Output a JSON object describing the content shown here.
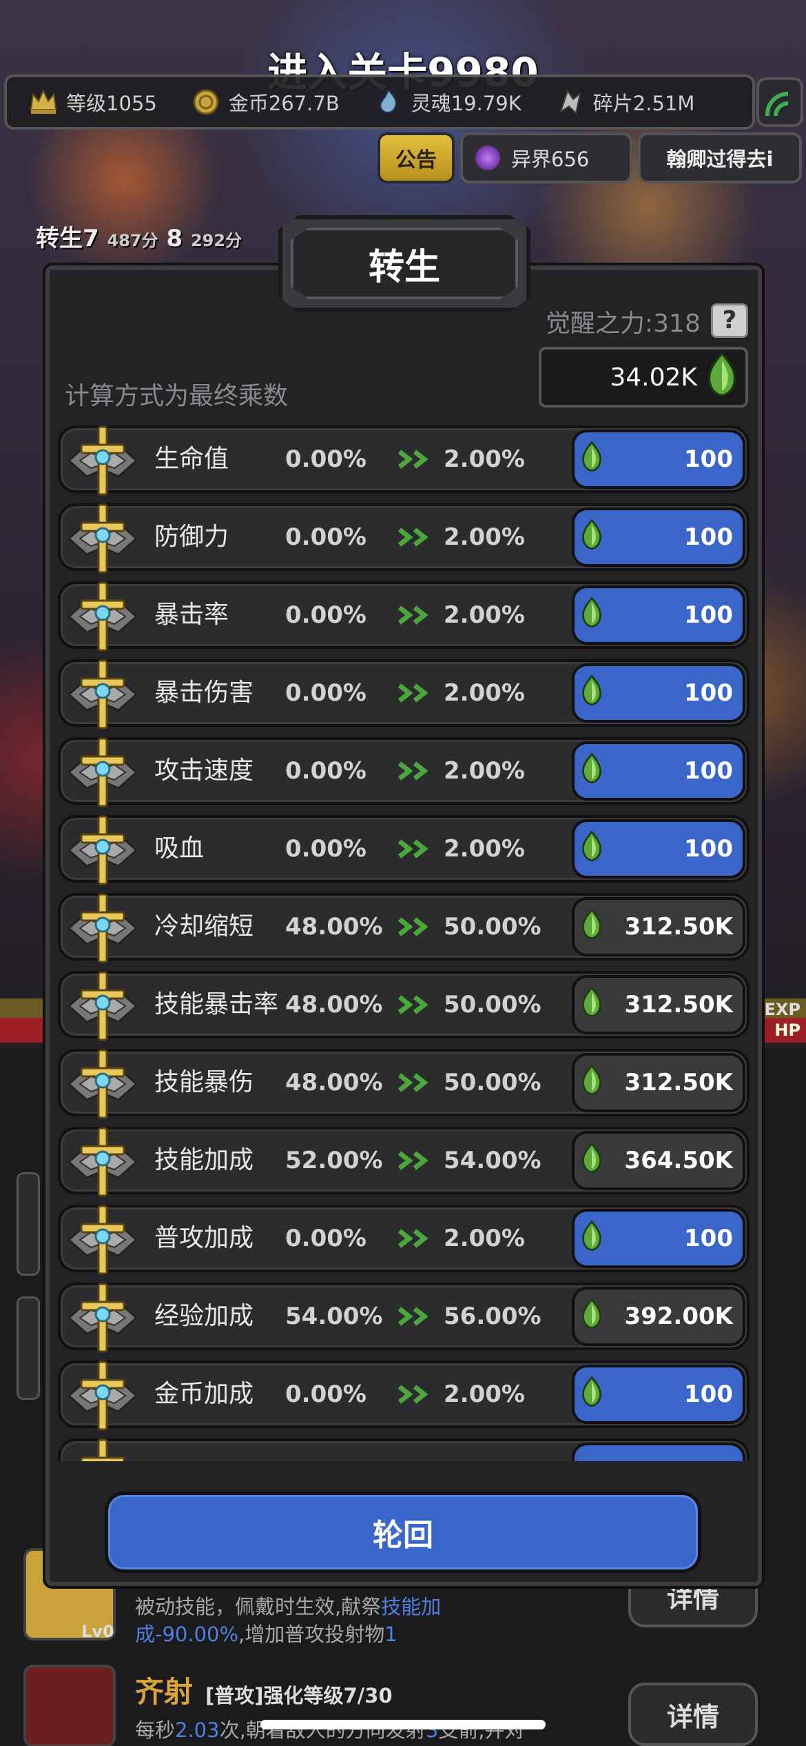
{
  "stage_title": "进入关卡9980",
  "currencies": [
    {
      "icon": "crown-icon",
      "label": "等级1055",
      "color": "#d6b04a"
    },
    {
      "icon": "gold-coin-icon",
      "label": "金币267.7B",
      "color": "#c9a43f"
    },
    {
      "icon": "soul-flame-icon",
      "label": "灵魂19.79K",
      "color": "#7fb0d8"
    },
    {
      "icon": "shard-icon",
      "label": "碎片2.51M",
      "color": "#bbbbbb"
    }
  ],
  "top_buttons": {
    "notice": "公告",
    "realm": "异界656",
    "player": "翰卿过得去i"
  },
  "rebirth_info": {
    "main": "转生7",
    "sub1": "487分",
    "mid": "8",
    "sub2": "292分"
  },
  "dialog": {
    "title": "转生",
    "awaken_power": "觉醒之力:318",
    "help": "?",
    "calc_note": "计算方式为最终乘数",
    "balance": "34.02K"
  },
  "rows": [
    {
      "name": "生命值",
      "current": "0.00%",
      "next": "2.00%",
      "cost": "100",
      "style": "blue"
    },
    {
      "name": "防御力",
      "current": "0.00%",
      "next": "2.00%",
      "cost": "100",
      "style": "blue"
    },
    {
      "name": "暴击率",
      "current": "0.00%",
      "next": "2.00%",
      "cost": "100",
      "style": "blue"
    },
    {
      "name": "暴击伤害",
      "current": "0.00%",
      "next": "2.00%",
      "cost": "100",
      "style": "blue"
    },
    {
      "name": "攻击速度",
      "current": "0.00%",
      "next": "2.00%",
      "cost": "100",
      "style": "blue"
    },
    {
      "name": "吸血",
      "current": "0.00%",
      "next": "2.00%",
      "cost": "100",
      "style": "blue"
    },
    {
      "name": "冷却缩短",
      "current": "48.00%",
      "next": "50.00%",
      "cost": "312.50K",
      "style": "grey"
    },
    {
      "name": "技能暴击率",
      "current": "48.00%",
      "next": "50.00%",
      "cost": "312.50K",
      "style": "grey"
    },
    {
      "name": "技能暴伤",
      "current": "48.00%",
      "next": "50.00%",
      "cost": "312.50K",
      "style": "grey"
    },
    {
      "name": "技能加成",
      "current": "52.00%",
      "next": "54.00%",
      "cost": "364.50K",
      "style": "grey"
    },
    {
      "name": "普攻加成",
      "current": "0.00%",
      "next": "2.00%",
      "cost": "100",
      "style": "blue"
    },
    {
      "name": "经验加成",
      "current": "54.00%",
      "next": "56.00%",
      "cost": "392.00K",
      "style": "grey"
    },
    {
      "name": "金币加成",
      "current": "0.00%",
      "next": "2.00%",
      "cost": "100",
      "style": "blue"
    },
    {
      "name": "",
      "current": "",
      "next": "",
      "cost": "",
      "style": "blue"
    }
  ],
  "reincarnate_label": "轮回",
  "hud": {
    "exp": "EXP",
    "hp": "HP"
  },
  "background_list": {
    "skill1": {
      "level": "Lv0",
      "desc_prefix": "被动技能，佩戴时生效,献祭",
      "desc_highlight": "技能加成-90.00%",
      "desc_suffix": ",增加普攻投射物",
      "desc_highlight2": "1",
      "detail": "详情"
    },
    "skill2": {
      "name": "齐射",
      "sub": "[普攻]强化等级7/30",
      "desc_prefix": "每秒",
      "desc_highlight": "2.03",
      "desc_mid": "次,朝着敌人的方向发射",
      "desc_highlight2": "3",
      "desc_suffix": "支箭,并对",
      "detail": "详情"
    }
  }
}
